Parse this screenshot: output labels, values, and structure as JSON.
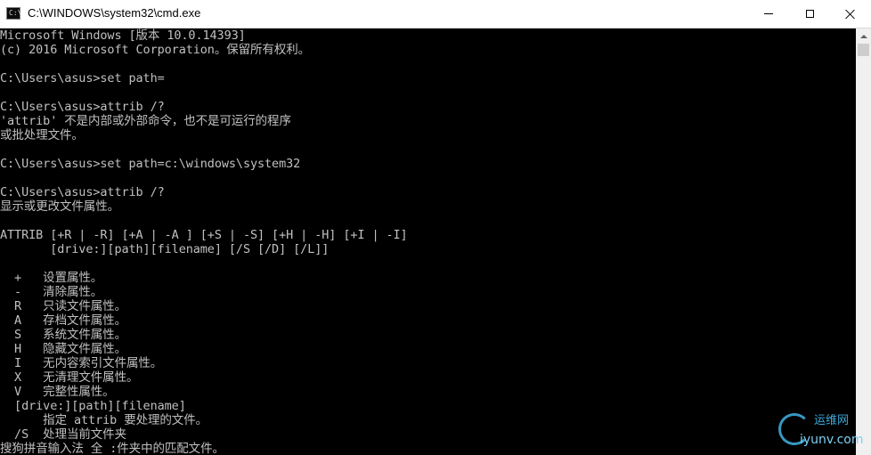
{
  "window": {
    "title": "C:\\WINDOWS\\system32\\cmd.exe",
    "icon": "cmd-icon",
    "icon_text": "C:\\"
  },
  "console": {
    "lines": [
      "Microsoft Windows [版本 10.0.14393]",
      "(c) 2016 Microsoft Corporation。保留所有权利。",
      "",
      "C:\\Users\\asus>set path=",
      "",
      "C:\\Users\\asus>attrib /?",
      "'attrib' 不是内部或外部命令，也不是可运行的程序",
      "或批处理文件。",
      "",
      "C:\\Users\\asus>set path=c:\\windows\\system32",
      "",
      "C:\\Users\\asus>attrib /?",
      "显示或更改文件属性。",
      "",
      "ATTRIB [+R | -R] [+A | -A ] [+S | -S] [+H | -H] [+I | -I]",
      "       [drive:][path][filename] [/S [/D] [/L]]",
      "",
      "  +   设置属性。",
      "  -   清除属性。",
      "  R   只读文件属性。",
      "  A   存档文件属性。",
      "  S   系统文件属性。",
      "  H   隐藏文件属性。",
      "  I   无内容索引文件属性。",
      "  X   无清理文件属性。",
      "  V   完整性属性。",
      "  [drive:][path][filename]",
      "      指定 attrib 要处理的文件。",
      "  /S  处理当前文件夹",
      "搜狗拼音输入法 全 :件夹中的匹配文件。"
    ]
  },
  "watermark": {
    "top": "运维网",
    "bottom": "iyunv.com"
  },
  "colors": {
    "console_bg": "#000000",
    "console_text": "#c0c0c0",
    "titlebar_bg": "#ffffff",
    "watermark": "#3fa9d8"
  }
}
